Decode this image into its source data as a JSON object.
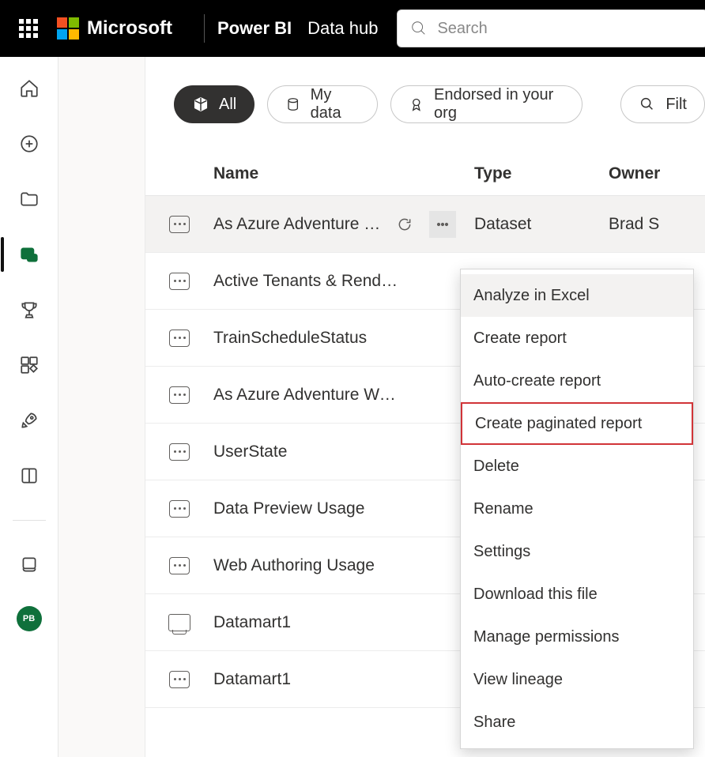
{
  "brand": {
    "company": "Microsoft",
    "product": "Power BI",
    "breadcrumb": "Data hub"
  },
  "search": {
    "placeholder": "Search",
    "value": ""
  },
  "avatar": {
    "initials": "PB"
  },
  "chips": {
    "all": "All",
    "my_data": "My data",
    "endorsed": "Endorsed in your org",
    "filter": "Filt"
  },
  "columns": {
    "name": "Name",
    "type": "Type",
    "owner": "Owner"
  },
  "rows": [
    {
      "name": "As Azure Adventure …",
      "type": "Dataset",
      "owner": "Brad S",
      "icon": "dataset",
      "display_name_full": false,
      "hovered": true
    },
    {
      "name": "Active Tenants & Renders",
      "type": "",
      "owner": "",
      "icon": "dataset"
    },
    {
      "name": "TrainScheduleStatus",
      "type": "",
      "owner": "",
      "icon": "dataset"
    },
    {
      "name": "As Azure Adventure Works II",
      "type": "",
      "owner": "",
      "icon": "dataset"
    },
    {
      "name": "UserState",
      "type": "",
      "owner": "",
      "icon": "dataset"
    },
    {
      "name": "Data Preview Usage",
      "type": "",
      "owner": "",
      "icon": "dataset"
    },
    {
      "name": "Web Authoring Usage",
      "type": "",
      "owner": "",
      "icon": "dataset"
    },
    {
      "name": "Datamart1",
      "type": "",
      "owner": "",
      "icon": "datamart"
    },
    {
      "name": "Datamart1",
      "type": "",
      "owner": "",
      "icon": "dataset"
    }
  ],
  "context_menu": {
    "items": [
      "Analyze in Excel",
      "Create report",
      "Auto-create report",
      "Create paginated report",
      "Delete",
      "Rename",
      "Settings",
      "Download this file",
      "Manage permissions",
      "View lineage",
      "Share"
    ],
    "hovered_index": 0,
    "highlighted_index": 3
  }
}
